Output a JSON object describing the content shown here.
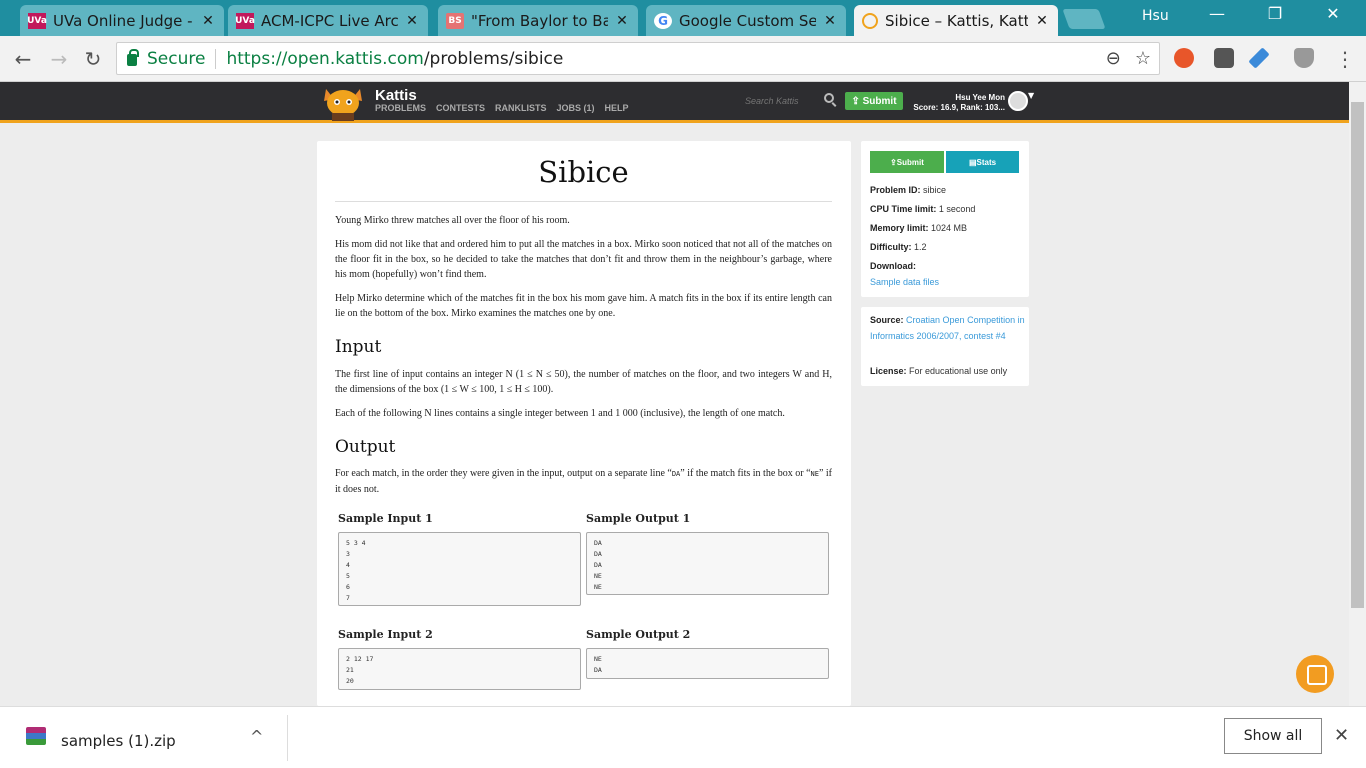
{
  "browser": {
    "tabs": [
      {
        "favicon": "UVa",
        "favicon_color": "#c2185b",
        "title": "UVa Online Judge - I",
        "close": "✕"
      },
      {
        "favicon": "UVa",
        "favicon_color": "#c2185b",
        "title": "ACM-ICPC Live Archi",
        "close": "✕"
      },
      {
        "favicon": "BS",
        "favicon_color": "#e57373",
        "title": "\"From Baylor to Bayl",
        "close": "✕"
      },
      {
        "favicon": "G",
        "favicon_color": "#4285f4",
        "title": "Google Custom Sear",
        "close": "✕"
      },
      {
        "favicon": "",
        "favicon_color": "#f0a31d",
        "title": "Sibice – Kattis, Kattis",
        "close": "✕"
      }
    ],
    "profile_name": "Hsu",
    "window_controls": {
      "minimize": "—",
      "restore": "❐",
      "close": "✕"
    },
    "nav": {
      "back": "←",
      "forward": "→",
      "reload": "↻"
    },
    "secure_label": "Secure",
    "url_host": "https://open.kattis.com",
    "url_path": "/problems/sibice",
    "omni_icons": {
      "zoom": "⊖",
      "bookmark": "☆"
    },
    "menu": "⋮"
  },
  "kattis": {
    "brand": "Kattis",
    "nav": [
      "PROBLEMS",
      "CONTESTS",
      "RANKLISTS",
      "JOBS (1)",
      "HELP"
    ],
    "search_placeholder": "Search Kattis",
    "submit_label": "Submit",
    "user_name": "Hsu Yee Mon",
    "user_score": "Score: 16.9, Rank: 103..."
  },
  "problem": {
    "title": "Sibice",
    "intro": "Young Mirko threw matches all over the floor of his room.",
    "para2": "His mom did not like that and ordered him to put all the matches in a box. Mirko soon noticed that not all of the matches on the floor fit in the box, so he decided to take the matches that don’t fit and throw them in the neighbour’s garbage, where his mom (hopefully) won’t find them.",
    "para3": "Help Mirko determine which of the matches fit in the box his mom gave him. A match fits in the box if its entire length can lie on the bottom of the box. Mirko examines the matches one by one.",
    "input_heading": "Input",
    "input_p1": "The first line of input contains an integer N (1 ≤ N ≤ 50), the number of matches on the floor, and two integers W and H, the dimensions of the box (1 ≤ W ≤ 100, 1 ≤ H ≤ 100).",
    "input_p2": "Each of the following N lines contains a single integer between 1 and 1 000 (inclusive), the length of one match.",
    "output_heading": "Output",
    "output_p_before": "For each match, in the order they were given in the input, output on a separate line “",
    "output_da": "DA",
    "output_p_mid": "” if the match fits in the box or “",
    "output_ne": "NE",
    "output_p_after": "” if it does not.",
    "samples": [
      {
        "in_label": "Sample Input 1",
        "input": "5 3 4\n3\n4\n5\n6\n7",
        "out_label": "Sample Output 1",
        "output": "DA\nDA\nDA\nNE\nNE"
      },
      {
        "in_label": "Sample Input 2",
        "input": "2 12 17\n21\n20",
        "out_label": "Sample Output 2",
        "output": "NE\nDA"
      }
    ]
  },
  "sidebar": {
    "submit_label": "Submit",
    "stats_label": "Stats",
    "problem_id_label": "Problem ID:",
    "problem_id": "sibice",
    "cpu_label": "CPU Time limit:",
    "cpu": "1 second",
    "memory_label": "Memory limit:",
    "memory": "1024 MB",
    "difficulty_label": "Difficulty:",
    "difficulty": "1.2",
    "download_label": "Download:",
    "download_link": "Sample data files",
    "source_label": "Source:",
    "source": "Croatian Open Competition in Informatics 2006/2007, contest #4",
    "license_label": "License:",
    "license": "For educational use only"
  },
  "downloads": {
    "file": "samples (1).zip",
    "caret": "^",
    "show_all": "Show all",
    "close": "✕"
  },
  "colors": {
    "accent": "#f0a31d",
    "submit_green": "#4cae4c",
    "stats_teal": "#17a2b8",
    "link": "#3a9ad9"
  }
}
